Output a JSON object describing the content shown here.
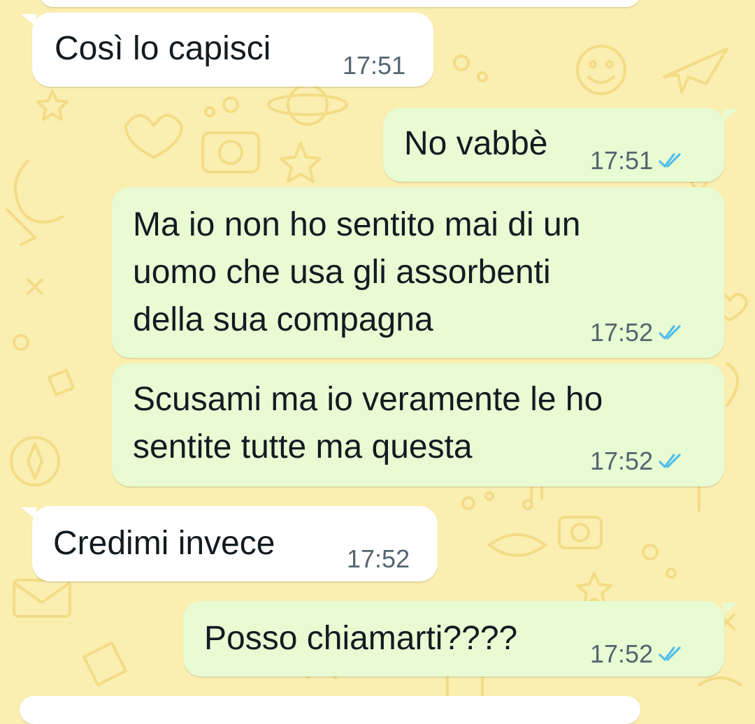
{
  "colors": {
    "wallpaper": "#fbeeb1",
    "wallpaper_doodle": "#f3dc86",
    "incoming_bubble": "#ffffff",
    "outgoing_bubble": "#e8fbd3",
    "text": "#111b21",
    "timestamp": "#54656f",
    "read_ticks": "#53bdeb"
  },
  "messages": [
    {
      "direction": "incoming",
      "text": "Così lo capisci",
      "time": "17:51"
    },
    {
      "direction": "outgoing",
      "text": "No vabbè",
      "time": "17:51",
      "status_icon": "double-check-read-icon"
    },
    {
      "direction": "outgoing",
      "lines": [
        "Ma io non ho sentito mai di un",
        "uomo che usa gli assorbenti",
        "della sua compagna"
      ],
      "time": "17:52",
      "status_icon": "double-check-read-icon"
    },
    {
      "direction": "outgoing",
      "lines": [
        "Scusami ma io veramente le ho",
        "sentite tutte ma questa"
      ],
      "time": "17:52",
      "status_icon": "double-check-read-icon"
    },
    {
      "direction": "incoming",
      "text": "Credimi invece",
      "time": "17:52"
    },
    {
      "direction": "outgoing",
      "text": "Posso chiamarti????",
      "time": "17:52",
      "status_icon": "double-check-read-icon"
    }
  ]
}
